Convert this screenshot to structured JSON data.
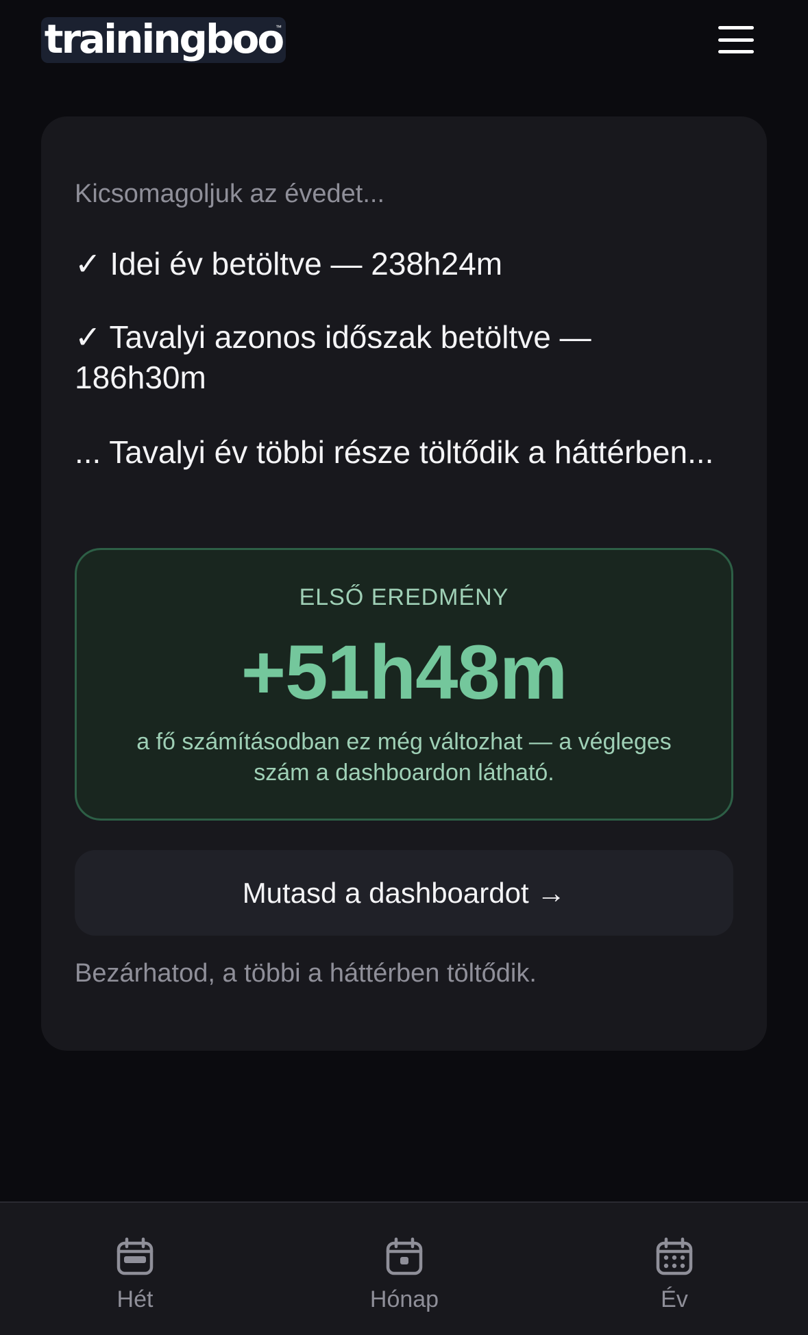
{
  "header": {
    "logo_text": "trainingboo",
    "logo_tm": "™",
    "menu_icon": "hamburger-menu-icon"
  },
  "card": {
    "intro": "Kicsomagoljuk az évedet...",
    "steps": [
      "✓ Idei év betöltve — 238h24m",
      "✓ Tavalyi azonos időszak betöltve — 186h30m",
      "... Tavalyi év többi része töltődik a háttérben..."
    ],
    "result": {
      "label": "ELSŐ EREDMÉNY",
      "value": "+51h48m",
      "note": "a fő számításodban ez még változhat — a végleges szám a dashboardon látható."
    },
    "dashboard_button": "Mutasd a dashboardot →",
    "footnote": "Bezárhatod, a többi a háttérben töltődik."
  },
  "bottom_nav": {
    "items": [
      {
        "label": "Hét",
        "icon": "calendar-week-icon"
      },
      {
        "label": "Hónap",
        "icon": "calendar-day-icon"
      },
      {
        "label": "Év",
        "icon": "calendar-grid-icon"
      }
    ]
  },
  "colors": {
    "background": "#0b0b0f",
    "card": "#18181d",
    "accent_green": "#74c79c",
    "result_bg": "#19261f",
    "muted_text": "#8f8f99"
  }
}
